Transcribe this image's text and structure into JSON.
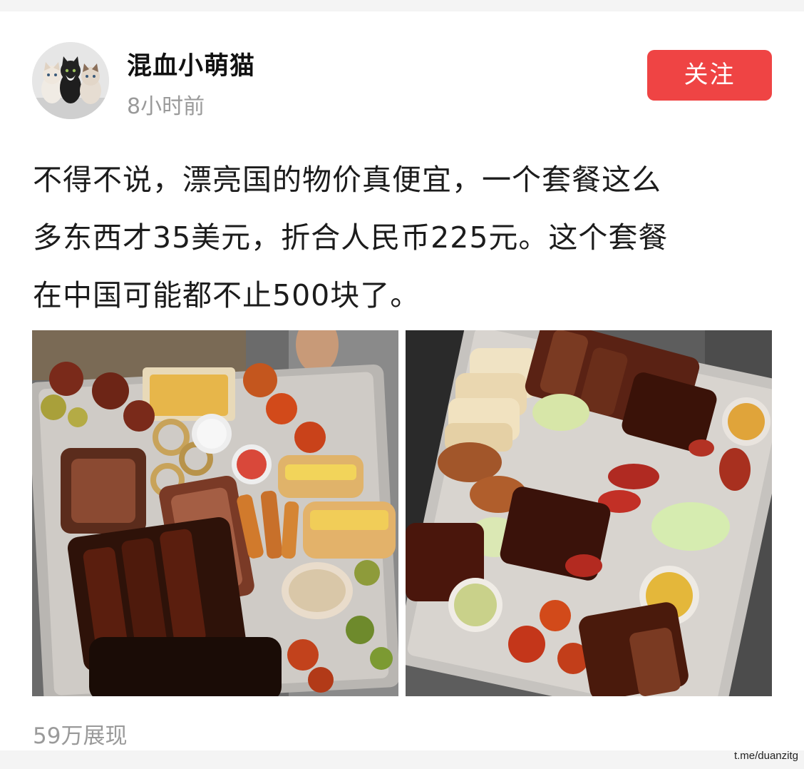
{
  "post": {
    "author": "混血小萌猫",
    "time": "8小时前",
    "follow_label": "关注",
    "text_lines": [
      "不得不说，漂亮国的物价真便宜，一个套餐这么",
      "多东西才35美元，折合人民币225元。这个套餐",
      "在中国可能都不止500块了。"
    ],
    "views": "59万展现"
  },
  "watermark": "t.me/duanzitg",
  "colors": {
    "follow_button": "#ef4444",
    "meta_text": "#9a9a9a"
  }
}
